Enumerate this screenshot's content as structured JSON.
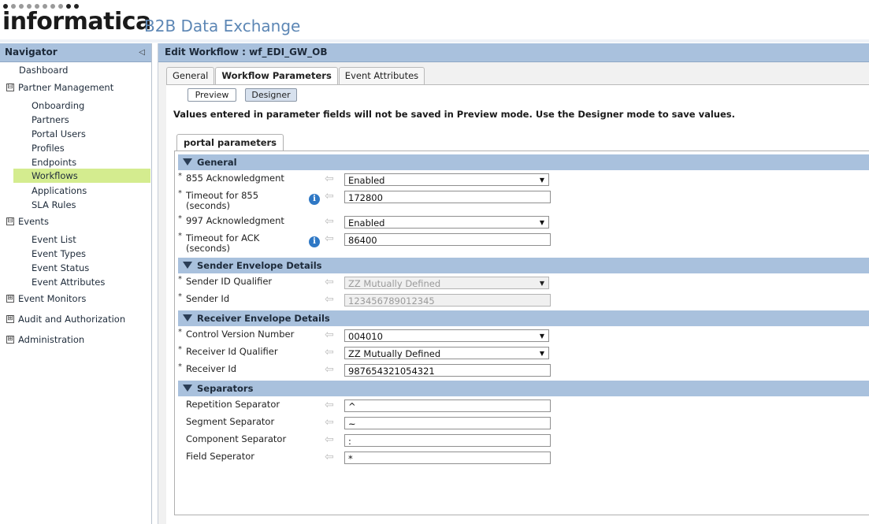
{
  "header": {
    "logo": "informatica",
    "product": "B2B Data Exchange"
  },
  "navigator": {
    "title": "Navigator",
    "items": [
      {
        "label": "Dashboard"
      },
      {
        "label": "Partner Management",
        "toggle": "⊟"
      },
      {
        "label": "Onboarding"
      },
      {
        "label": "Partners"
      },
      {
        "label": "Portal Users"
      },
      {
        "label": "Profiles"
      },
      {
        "label": "Endpoints"
      },
      {
        "label": "Workflows",
        "selected": true
      },
      {
        "label": "Applications"
      },
      {
        "label": "SLA Rules"
      },
      {
        "label": "Events",
        "toggle": "⊟"
      },
      {
        "label": "Event List"
      },
      {
        "label": "Event Types"
      },
      {
        "label": "Event Status"
      },
      {
        "label": "Event Attributes"
      },
      {
        "label": "Event Monitors",
        "toggle": "⊞"
      },
      {
        "label": "Audit and Authorization",
        "toggle": "⊞"
      },
      {
        "label": "Administration",
        "toggle": "⊞"
      }
    ]
  },
  "main": {
    "title": "Edit Workflow : wf_EDI_GW_OB",
    "tabs": [
      {
        "label": "General"
      },
      {
        "label": "Workflow Parameters",
        "active": true
      },
      {
        "label": "Event Attributes"
      }
    ],
    "modes": {
      "preview": "Preview",
      "designer": "Designer"
    },
    "notice": "Values entered in parameter fields will not be saved in Preview mode. Use the Designer mode to save values.",
    "subtab": "portal parameters",
    "sections": {
      "general": {
        "title": "General",
        "ack855": {
          "label": "855 Acknowledgment",
          "value": "Enabled"
        },
        "timeout855": {
          "label_1": "Timeout for 855",
          "label_2": "(seconds)",
          "value": "172800"
        },
        "ack997": {
          "label": "997 Acknowledgment",
          "value": "Enabled"
        },
        "timeoutAck": {
          "label_1": "Timeout for ACK",
          "label_2": "(seconds)",
          "value": "86400"
        }
      },
      "sender": {
        "title": "Sender Envelope Details",
        "qualifier": {
          "label": "Sender ID Qualifier",
          "value": "ZZ Mutually Defined"
        },
        "id": {
          "label": "Sender Id",
          "value": "123456789012345"
        }
      },
      "receiver": {
        "title": "Receiver Envelope Details",
        "control": {
          "label": "Control Version Number",
          "value": "004010"
        },
        "qualifier": {
          "label": "Receiver Id Qualifier",
          "value": "ZZ Mutually Defined"
        },
        "id": {
          "label": "Receiver Id",
          "value": "987654321054321"
        }
      },
      "separators": {
        "title": "Separators",
        "repetition": {
          "label": "Repetition Separator",
          "value": "^"
        },
        "segment": {
          "label": "Segment Separator",
          "value": "~"
        },
        "component": {
          "label": "Component Separator",
          "value": ":"
        },
        "field": {
          "label": "Field Seperator",
          "value": "*"
        }
      }
    }
  },
  "symbols": {
    "required": "*",
    "info": "i",
    "revert": "⇦",
    "dropdown": "▼",
    "collapse": "◁"
  },
  "colors": {
    "section_bg": "#a9c1dd",
    "selected_nav": "#d4ec8f",
    "product_blue": "#5d87b5"
  }
}
